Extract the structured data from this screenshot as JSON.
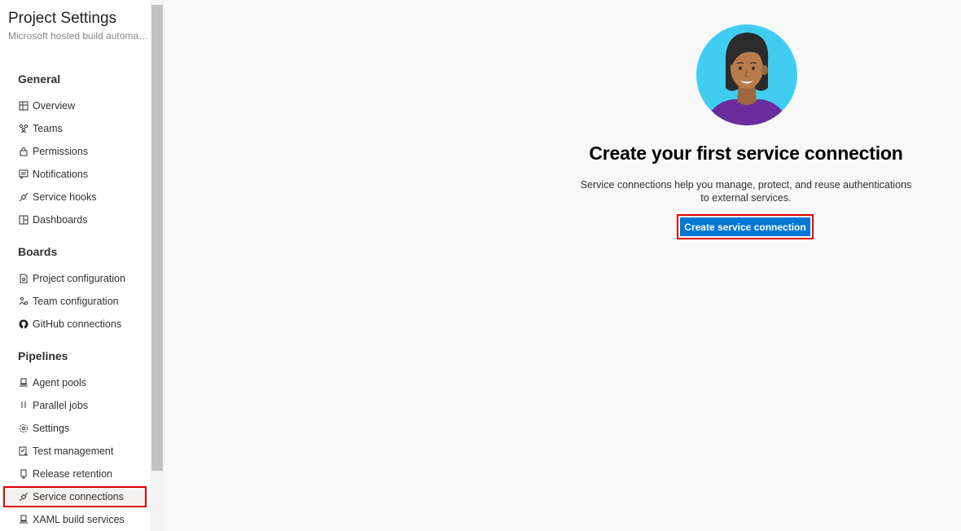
{
  "sidebar": {
    "title": "Project Settings",
    "subtitle": "Microsoft hosted build automation",
    "sections": [
      {
        "title": "General",
        "items": [
          {
            "label": "Overview",
            "icon": "overview-icon"
          },
          {
            "label": "Teams",
            "icon": "teams-icon"
          },
          {
            "label": "Permissions",
            "icon": "lock-icon"
          },
          {
            "label": "Notifications",
            "icon": "notifications-icon"
          },
          {
            "label": "Service hooks",
            "icon": "plug-icon"
          },
          {
            "label": "Dashboards",
            "icon": "dashboards-icon"
          }
        ]
      },
      {
        "title": "Boards",
        "items": [
          {
            "label": "Project configuration",
            "icon": "project-config-icon"
          },
          {
            "label": "Team configuration",
            "icon": "team-config-icon"
          },
          {
            "label": "GitHub connections",
            "icon": "github-icon"
          }
        ]
      },
      {
        "title": "Pipelines",
        "items": [
          {
            "label": "Agent pools",
            "icon": "agent-pools-icon"
          },
          {
            "label": "Parallel jobs",
            "icon": "parallel-jobs-icon"
          },
          {
            "label": "Settings",
            "icon": "gear-icon"
          },
          {
            "label": "Test management",
            "icon": "test-management-icon"
          },
          {
            "label": "Release retention",
            "icon": "phone-icon"
          },
          {
            "label": "Service connections",
            "icon": "plug-icon",
            "selected": true
          },
          {
            "label": "XAML build services",
            "icon": "agent-pools-icon"
          }
        ]
      }
    ]
  },
  "main": {
    "title": "Create your first service connection",
    "description": "Service connections help you manage, protect, and reuse authentications to external services.",
    "button_label": "Create service connection"
  },
  "colors": {
    "accent": "#0078d4",
    "highlight": "#e00000"
  }
}
